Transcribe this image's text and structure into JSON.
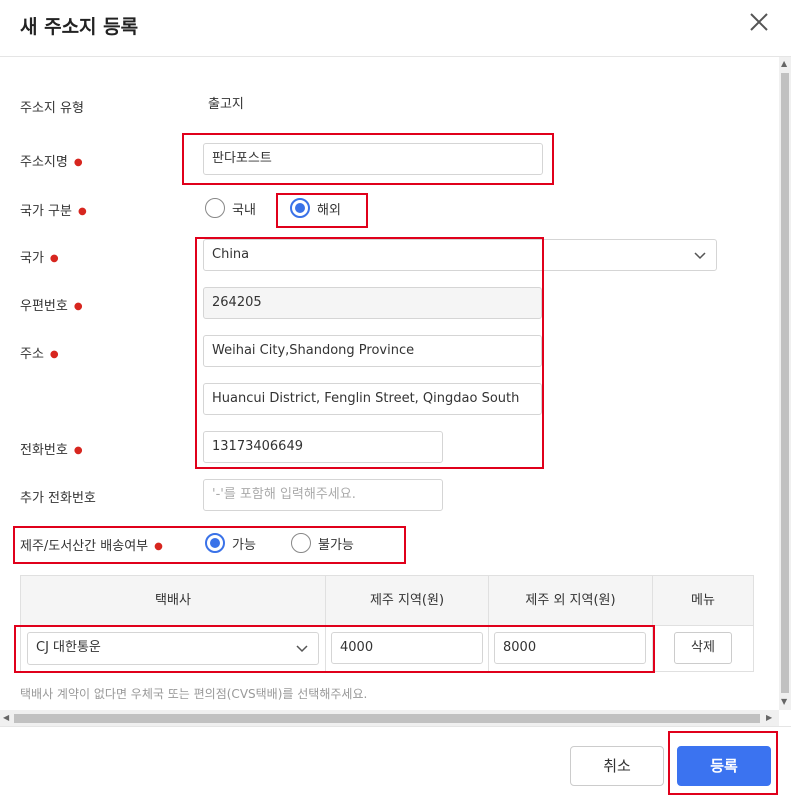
{
  "dialog": {
    "title": "새 주소지 등록"
  },
  "form": {
    "address_type": {
      "label": "주소지 유형",
      "value": "출고지"
    },
    "address_name": {
      "label": "주소지명",
      "value": "판다포스트"
    },
    "country_type": {
      "label": "국가 구분",
      "options": [
        "국내",
        "해외"
      ],
      "selected": "해외"
    },
    "country": {
      "label": "국가",
      "value": "China"
    },
    "postal_code": {
      "label": "우편번호",
      "value": "264205"
    },
    "address": {
      "label": "주소",
      "line1": "Weihai City,Shandong Province",
      "line2": "Huancui District, Fenglin Street, Qingdao South"
    },
    "phone": {
      "label": "전화번호",
      "value": "13173406649"
    },
    "extra_phone": {
      "label": "추가 전화번호",
      "placeholder": "'-'를 포함해 입력해주세요."
    },
    "jeju_delivery": {
      "label": "제주/도서산간 배송여부",
      "options": [
        "가능",
        "불가능"
      ],
      "selected": "가능"
    }
  },
  "courier_table": {
    "headers": [
      "택배사",
      "제주 지역(원)",
      "제주 외 지역(원)",
      "메뉴"
    ],
    "rows": [
      {
        "courier": "CJ 대한통운",
        "jeju_fee": "4000",
        "non_jeju_fee": "8000",
        "action": "삭제"
      }
    ],
    "hint": "택배사 계약이 없다면 우체국 또는 편의점(CVS택배)를 선택해주세요."
  },
  "footer": {
    "cancel_label": "취소",
    "submit_label": "등록"
  },
  "colors": {
    "accent": "#3b73f0",
    "required_dot": "#d7261f",
    "highlight_box": "#e0001b"
  }
}
